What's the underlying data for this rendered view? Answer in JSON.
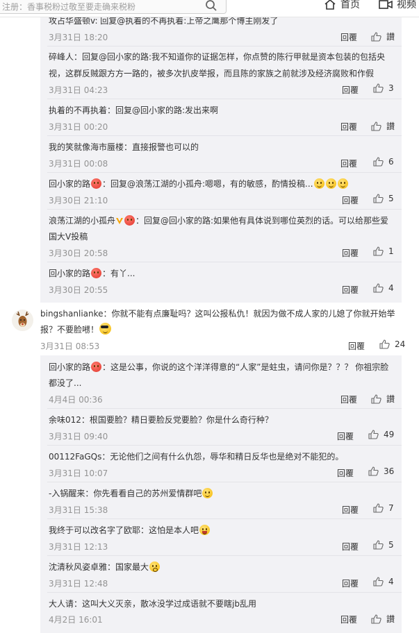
{
  "header": {
    "search_placeholder": "注册：香事税粉过敬至要走确来税粉",
    "home_label": "首页",
    "video_label": "视频"
  },
  "reply_label": "回覆",
  "praise_label": "讃",
  "comments": [
    {
      "line1": "攻占华盛顿v: 回复@执着的不再执着:上帝之鹰那个博主刚发了",
      "line2": "",
      "time": "3月31日 18:20",
      "likes": "讃"
    },
    {
      "line1": "碎峰人：回复@回小家的路:我不知道你的证据怎样，你点赞的陈行甲就是资本包装的包括央",
      "line2": "视，这群反贼跟方方一路的，被多次扒皮举报，而且陈的家族之前就涉及经济腐败和作假",
      "time": "3月31日 04:23",
      "likes": "3"
    },
    {
      "line1": "执着的不再执着：回复@回小家的路:发出来啊",
      "line2": "",
      "time": "3月31日 00:20",
      "likes": "讃"
    },
    {
      "line1": "我的笑就像海市蜃楼：直接报警也可以的",
      "line2": "",
      "time": "3月31日 00:08",
      "likes": "6"
    },
    {
      "line1_name": "回小家的路",
      "line1_text": "：回复@浪荡江湖的小孤舟:嗯嗯，有的敏感，酌情投稿...",
      "line2": "",
      "time": "3月30日 21:10",
      "likes": "5"
    },
    {
      "line1_name": "浪荡江湖的小孤舟",
      "line1_text": "：回复@回小家的路:如果他有具体说到哪位英烈的话。可以给那些爱",
      "line2": "国大V投稿",
      "time": "3月30日 20:58",
      "likes": "1"
    },
    {
      "line1_name": "回小家的路",
      "line1_text": "：有丫...",
      "line2": "",
      "time": "3月30日 20:55",
      "likes": "4"
    }
  ],
  "main_comment": {
    "line1": "bingshanlianke：你就不能有点廉耻吗？这叫公报私仇！就因为做不成人家的儿媳了你就开始举",
    "line2": "报？不要脸㘄！",
    "time": "3月31日 08:53",
    "likes": "24"
  },
  "replies": [
    {
      "line1_name": "回小家的路",
      "line1_text": "：这是公事，你说的这个洋洋得意的“人家”是蛀虫，请问你是？？？ 你祖宗脸",
      "line2": "都没了...",
      "time": "4月4日 00:36",
      "likes": "讃"
    },
    {
      "line1": "余味012：根国要脸？精日要脸反党要脸？你是什么奇行种？",
      "time": "3月31日 09:40",
      "likes": "49"
    },
    {
      "line1": "00112FaGQs：无论他们之间有什么仇怨，辱华和精日反华也是绝对不能犯的。",
      "time": "3月31日 10:07",
      "likes": "36"
    },
    {
      "line1": "-入锅醒来：你先看看自己的苏州爱情群吧",
      "time": "3月31日 15:38",
      "likes": "7"
    },
    {
      "line1": "我终于可以改名字了欧耶：这怕是本人吧",
      "time": "3月31日 12:13",
      "likes": "5"
    },
    {
      "line1": "沈清秋风姿卓雅：国家最大",
      "time": "3月31日 12:48",
      "likes": "4"
    },
    {
      "line1": "大人请：这叫大义灭亲，散冰没学过成语就不要瞎jb乱用",
      "time": "4月2日 16:01",
      "likes": "讃"
    }
  ]
}
